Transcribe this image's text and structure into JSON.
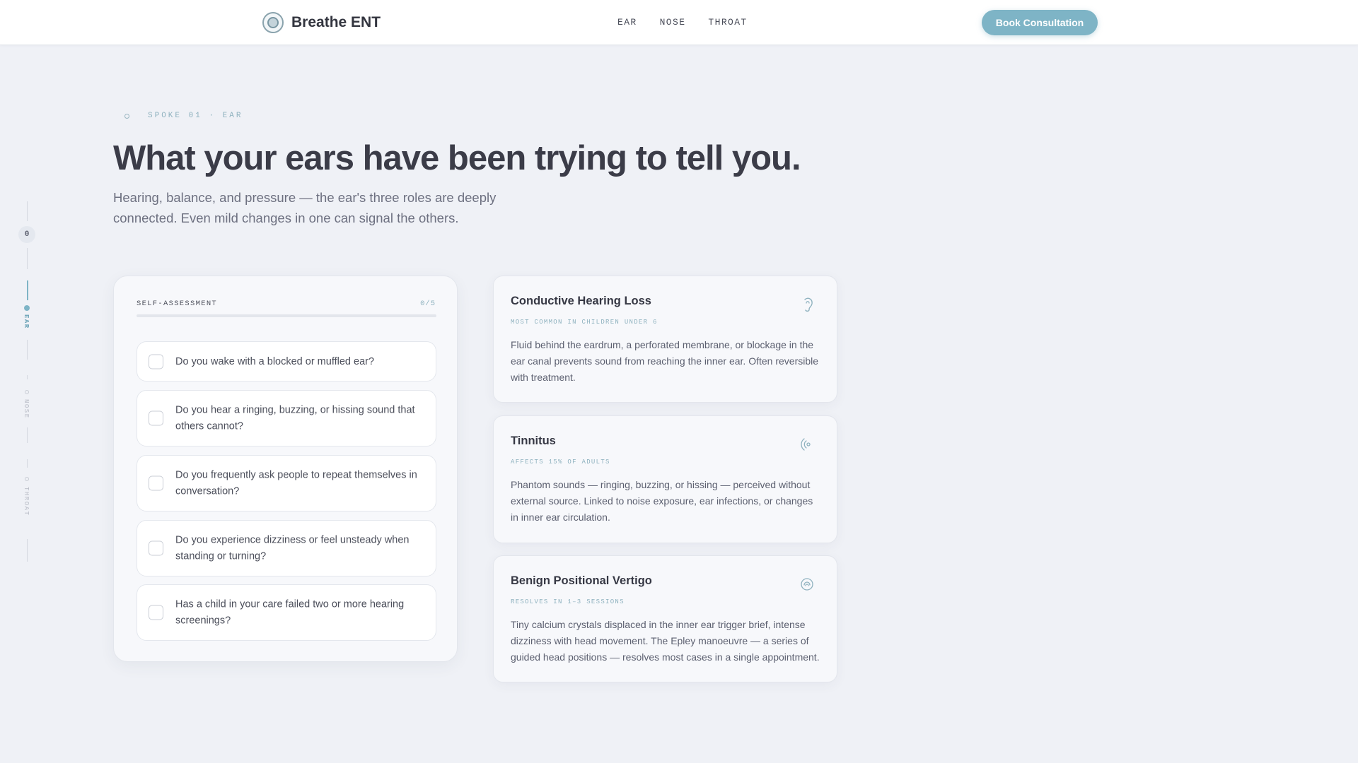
{
  "header": {
    "brand": "Breathe ENT",
    "nav": [
      "EAR",
      "NOSE",
      "THROAT"
    ],
    "cta_label": "Book Consultation"
  },
  "rail": {
    "counter": "0",
    "sections": [
      {
        "label": "EAR",
        "active": true
      },
      {
        "label": "NOSE",
        "active": false
      },
      {
        "label": "THROAT",
        "active": false
      }
    ]
  },
  "hero": {
    "eyebrow": "SPOKE 01 · EAR",
    "title": "What your ears have been trying to tell you.",
    "subtitle": "Hearing, balance, and pressure — the ear's three roles are deeply connected. Even mild changes in one can signal the others."
  },
  "assessment": {
    "label": "SELF-ASSESSMENT",
    "count": "0/5",
    "progress_fraction": 0,
    "questions": [
      "Do you wake with a blocked or muffled ear?",
      "Do you hear a ringing, buzzing, or hissing sound that others cannot?",
      "Do you frequently ask people to repeat themselves in conversation?",
      "Do you experience dizziness or feel unsteady when standing or turning?",
      "Has a child in your care failed two or more hearing screenings?"
    ]
  },
  "conditions": [
    {
      "title": "Conductive Hearing Loss",
      "tag": "MOST COMMON IN CHILDREN UNDER 6",
      "body": "Fluid behind the eardrum, a perforated membrane, or blockage in the ear canal prevents sound from reaching the inner ear. Often reversible with treatment.",
      "icon": "ear-icon"
    },
    {
      "title": "Tinnitus",
      "tag": "AFFECTS 15% OF ADULTS",
      "body": "Phantom sounds — ringing, buzzing, or hissing — perceived without external source. Linked to noise exposure, ear infections, or changes in inner ear circulation.",
      "icon": "sound-wave-icon"
    },
    {
      "title": "Benign Positional Vertigo",
      "tag": "RESOLVES IN 1–3 SESSIONS",
      "body": "Tiny calcium crystals displaced in the inner ear trigger brief, intense dizziness with head movement. The Epley manoeuvre — a series of guided head positions — resolves most cases in a single appointment.",
      "icon": "spiral-icon"
    }
  ],
  "colors": {
    "accent": "#7eb4c6",
    "background": "#eff1f6",
    "card": "#f7f8fb",
    "heading": "#3b3c48"
  }
}
